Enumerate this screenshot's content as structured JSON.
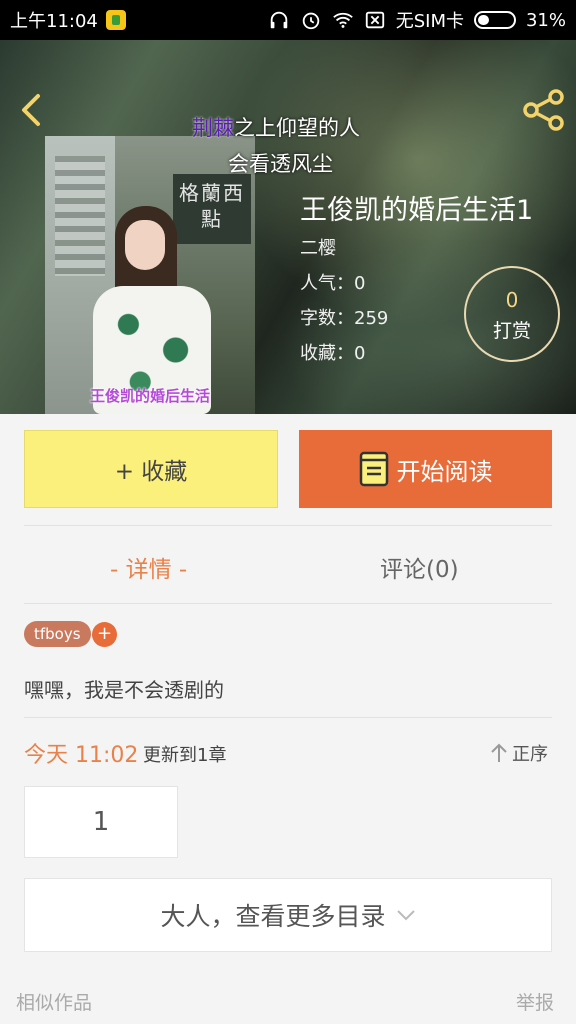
{
  "status_bar": {
    "time": "上午11:04",
    "carrier": "无SIM卡",
    "battery": "31%"
  },
  "lyrics": {
    "line1_highlight": "荆棘",
    "line1_rest": "之上仰望的人",
    "line2": "会看透风尘"
  },
  "book": {
    "title": "王俊凯的婚后生活1",
    "author": "二樱",
    "popularity": "人气：0",
    "word_count": "字数：259",
    "favorites": "收藏：0",
    "cover_sign": "格蘭西點",
    "cover_caption": "王俊凯的婚后生活"
  },
  "tip": {
    "count": "0",
    "label": "打赏"
  },
  "actions": {
    "collect_label": "+ 收藏",
    "read_label": "开始阅读"
  },
  "tabs": {
    "detail": "- 详情 -",
    "comments": "评论(0)"
  },
  "tag": "tfboys",
  "tag_add": "+",
  "description": "嘿嘿，我是不会透剧的",
  "update": {
    "time": "今天 11:02",
    "text": "更新到1章",
    "order_label": "正序"
  },
  "chapters": [
    "1"
  ],
  "more_catalog": "大人，查看更多目录",
  "footer": {
    "similar": "相似作品",
    "report": "举报"
  },
  "colors": {
    "accent_orange": "#e86b3a",
    "collect_yellow": "#fcf07c"
  }
}
